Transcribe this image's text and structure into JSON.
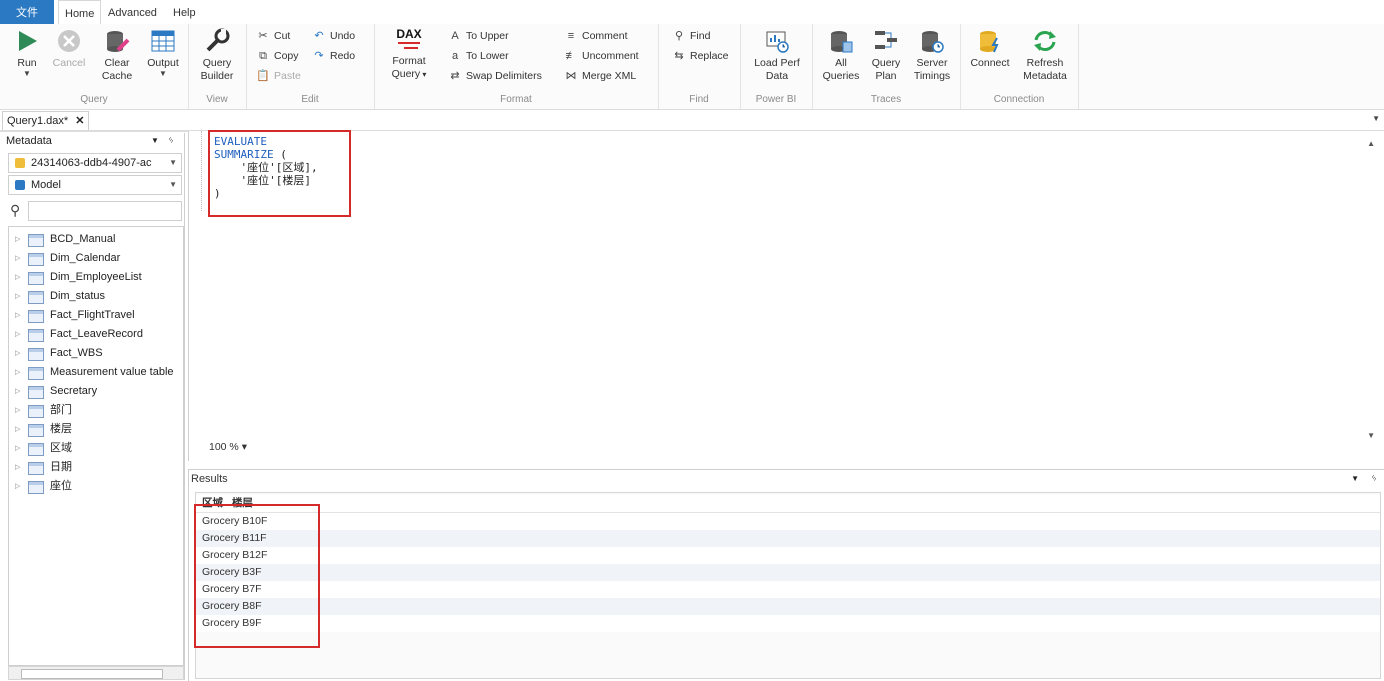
{
  "tabs": {
    "file": "文件",
    "home": "Home",
    "advanced": "Advanced",
    "help": "Help"
  },
  "ribbon": {
    "query": {
      "label": "Query",
      "run": "Run",
      "cancel": "Cancel",
      "clear_cache_1": "Clear",
      "clear_cache_2": "Cache",
      "output": "Output"
    },
    "view": {
      "label": "View",
      "query_builder_1": "Query",
      "query_builder_2": "Builder"
    },
    "edit": {
      "label": "Edit",
      "cut": "Cut",
      "copy": "Copy",
      "paste": "Paste",
      "undo": "Undo",
      "redo": "Redo"
    },
    "format": {
      "label": "Format",
      "format_query_1": "Format",
      "format_query_2": "Query",
      "dax_label": "DAX",
      "to_upper": "To Upper",
      "to_lower": "To Lower",
      "swap_delimiters": "Swap Delimiters",
      "comment": "Comment",
      "uncomment": "Uncomment",
      "merge_xml": "Merge XML"
    },
    "find": {
      "label": "Find",
      "find": "Find",
      "replace": "Replace"
    },
    "powerbi": {
      "label": "Power BI",
      "load_perf_1": "Load Perf",
      "load_perf_2": "Data"
    },
    "traces": {
      "label": "Traces",
      "all_queries_1": "All",
      "all_queries_2": "Queries",
      "query_plan_1": "Query",
      "query_plan_2": "Plan",
      "server_timings_1": "Server",
      "server_timings_2": "Timings"
    },
    "connection": {
      "label": "Connection",
      "connect": "Connect",
      "refresh_1": "Refresh",
      "refresh_2": "Metadata"
    }
  },
  "document": {
    "tab_title": "Query1.dax*"
  },
  "metadata": {
    "title": "Metadata",
    "pin": "ᛃ",
    "database": "24314063-ddb4-4907-ac",
    "model": "Model",
    "tables": [
      "BCD_Manual",
      "Dim_Calendar",
      "Dim_EmployeeList",
      "Dim_status",
      "Fact_FlightTravel",
      "Fact_LeaveRecord",
      "Fact_WBS",
      "Measurement value table",
      "Secretary",
      "部门",
      "楼层",
      "区域",
      "日期",
      "座位"
    ]
  },
  "editor": {
    "line1": "EVALUATE",
    "line2_kw": "SUMMARIZE",
    "line2_rest": " (",
    "line3": "    '座位'",
    "line3_col": "[区域]",
    "line3_sep": ",",
    "line4": "    '座位'",
    "line4_col": "[楼层]",
    "line5": ")",
    "zoom": "100 %"
  },
  "results": {
    "title": "Results",
    "columns": [
      "区域",
      "楼层"
    ],
    "rows": [
      "Grocery B10F",
      "Grocery B11F",
      "Grocery B12F",
      "Grocery B3F",
      "Grocery B7F",
      "Grocery B8F",
      "Grocery B9F"
    ]
  },
  "colors": {
    "accent": "#2b79c2",
    "highlight_box": "#d42a2a",
    "keyword": "#1f5fbf"
  }
}
